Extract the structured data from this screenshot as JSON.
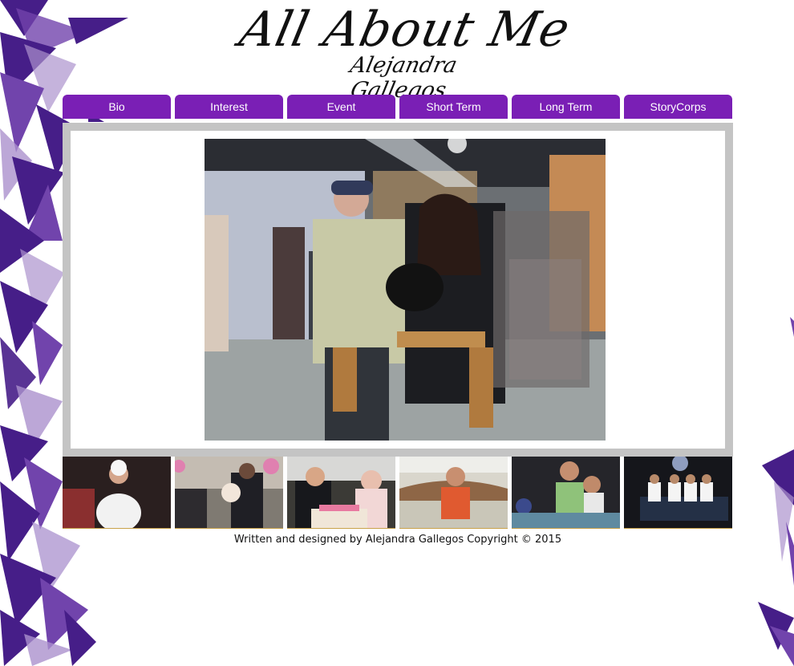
{
  "header": {
    "title": "All About Me",
    "subtitle": "Alejandra Gallegos"
  },
  "nav": {
    "tabs": [
      {
        "label": "Bio"
      },
      {
        "label": "Interest"
      },
      {
        "label": "Event"
      },
      {
        "label": "Short Term"
      },
      {
        "label": "Long Term"
      },
      {
        "label": "StoryCorps"
      }
    ]
  },
  "footer": {
    "text": "Written and designed by Alejandra Gallegos Copyright © 2015"
  },
  "colors": {
    "nav_purple": "#7a1fb5",
    "frame_gray": "#c4c4c4",
    "shard_dark": "#3d1282",
    "shard_mid": "#6a3aa8",
    "shard_light": "#a68bcb"
  }
}
